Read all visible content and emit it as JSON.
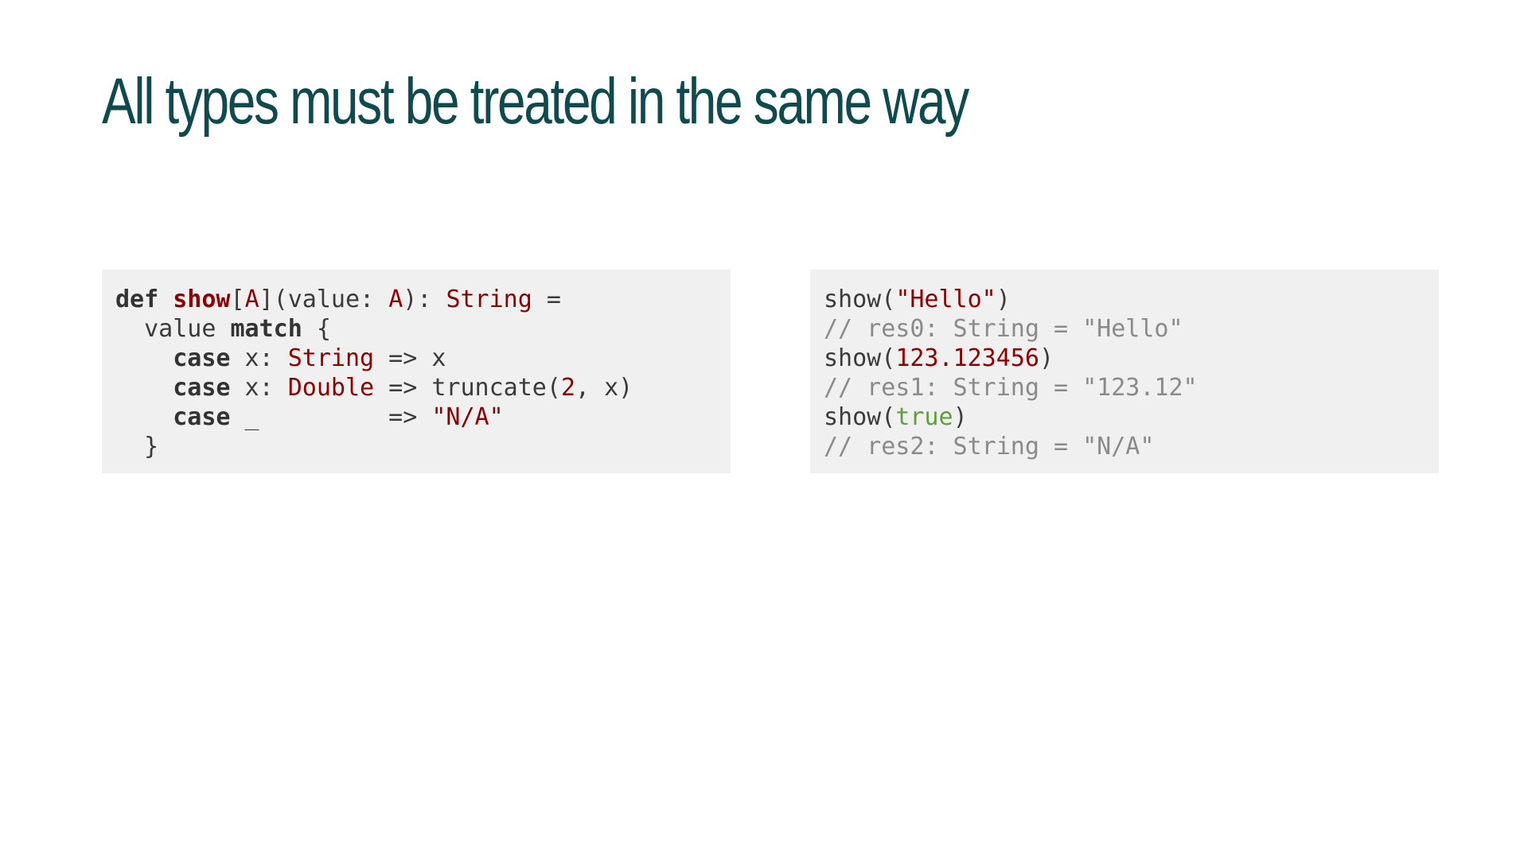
{
  "slide": {
    "title": "All types must be treated in the same way"
  },
  "left_code": {
    "line1": {
      "kw_def": "def",
      "sp1": " ",
      "fn_name": "show",
      "p1": "[",
      "type_a": "A",
      "p2": "](value: ",
      "type_a2": "A",
      "p3": "): ",
      "type_string": "String",
      "p4": " ="
    },
    "line2": {
      "indent": "  value ",
      "kw_match": "match",
      "brace": " {"
    },
    "line3": {
      "indent": "    ",
      "kw_case": "case",
      "p1": " x: ",
      "type_string": "String",
      "p2": " => x"
    },
    "line4": {
      "indent": "    ",
      "kw_case": "case",
      "p1": " x: ",
      "type_double": "Double",
      "p2": " => truncate(",
      "num_2": "2",
      "p3": ", x)"
    },
    "line5": {
      "indent": "    ",
      "kw_case": "case",
      "p1": " _         => ",
      "str_na": "\"N/A\""
    },
    "line6": {
      "text": "  }"
    }
  },
  "right_code": {
    "line1": {
      "call": "show(",
      "str_hello": "\"Hello\"",
      "close": ")"
    },
    "line2": {
      "comment": "// res0: String = \"Hello\""
    },
    "line3": {
      "call": "show(",
      "num_value": "123.123456",
      "close": ")"
    },
    "line4": {
      "comment": "// res1: String = \"123.12\""
    },
    "line5": {
      "call": "show(",
      "bool_true": "true",
      "close": ")"
    },
    "line6": {
      "comment": "// res2: String = \"N/A\""
    }
  }
}
